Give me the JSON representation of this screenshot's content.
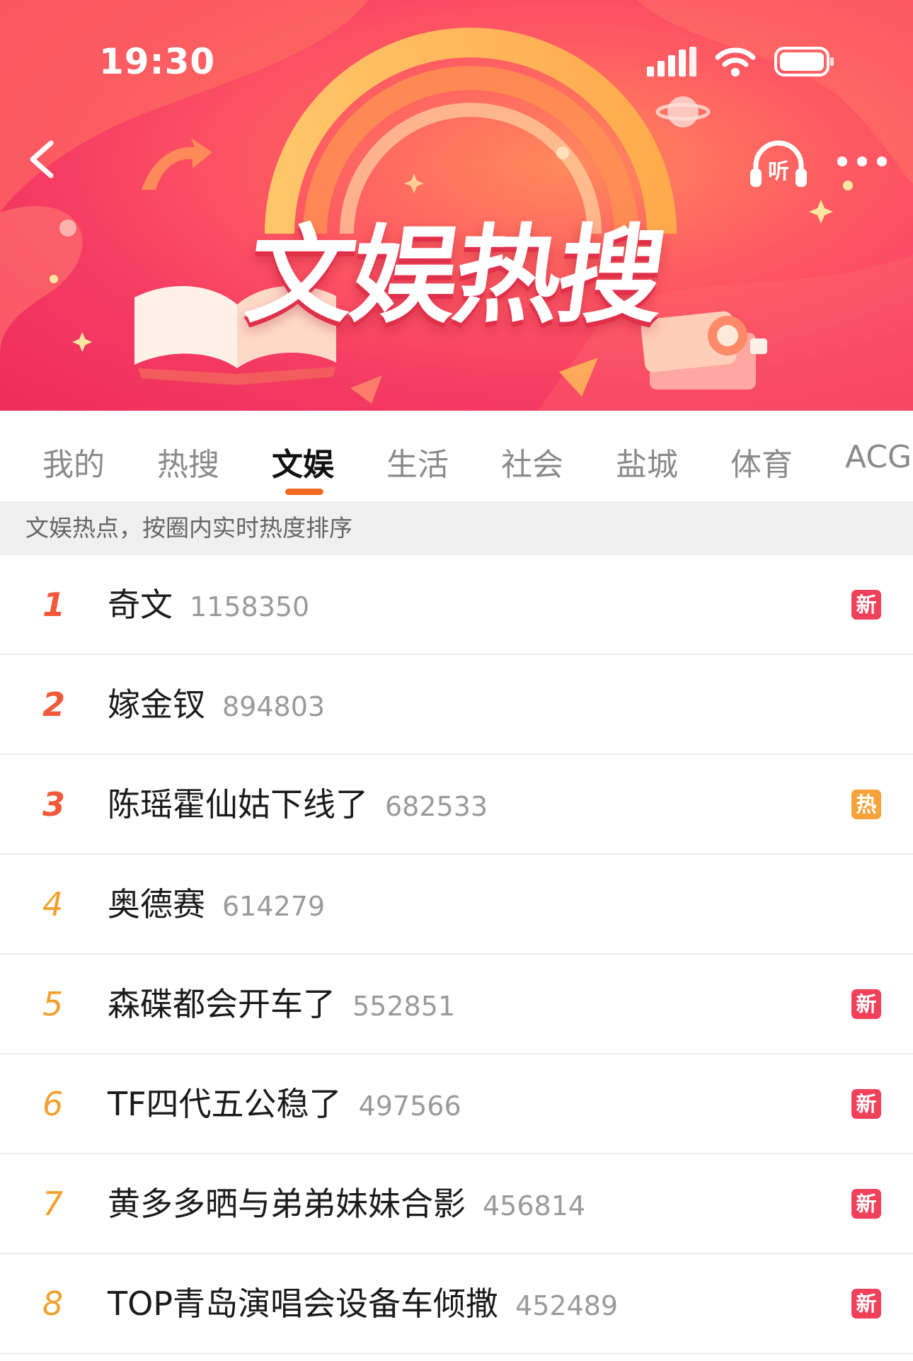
{
  "status_bar": {
    "time": "19:30"
  },
  "header": {
    "title": "文娱热搜",
    "listen_label": "听"
  },
  "tabs": [
    {
      "label": "我的"
    },
    {
      "label": "热搜"
    },
    {
      "label": "文娱",
      "active": true
    },
    {
      "label": "生活"
    },
    {
      "label": "社会"
    },
    {
      "label": "盐城"
    },
    {
      "label": "体育"
    },
    {
      "label": "ACG"
    }
  ],
  "subheader": {
    "text": "文娱热点，按圈内实时热度排序"
  },
  "items": [
    {
      "rank": "1",
      "title": "奇文",
      "count": "1158350",
      "badge": "新"
    },
    {
      "rank": "2",
      "title": "嫁金钗",
      "count": "894803",
      "badge": ""
    },
    {
      "rank": "3",
      "title": "陈瑶霍仙姑下线了",
      "count": "682533",
      "badge": "热"
    },
    {
      "rank": "4",
      "title": "奥德赛",
      "count": "614279",
      "badge": ""
    },
    {
      "rank": "5",
      "title": "森碟都会开车了",
      "count": "552851",
      "badge": "新"
    },
    {
      "rank": "6",
      "title": "TF四代五公稳了",
      "count": "497566",
      "badge": "新"
    },
    {
      "rank": "7",
      "title": "黄多多晒与弟弟妹妹合影",
      "count": "456814",
      "badge": "新"
    },
    {
      "rank": "8",
      "title": "TOP青岛演唱会设备车倾撒",
      "count": "452489",
      "badge": "新"
    }
  ],
  "colors": {
    "accent": "#f26b21",
    "rank_top": "#f05a3a",
    "rank_other": "#f2a12e",
    "badge_new": "#f0405a",
    "badge_hot": "#f7a23a"
  },
  "icons": [
    "back-arrow-icon",
    "headphones-icon",
    "more-dots-icon",
    "signal-icon",
    "wifi-icon",
    "battery-icon"
  ]
}
